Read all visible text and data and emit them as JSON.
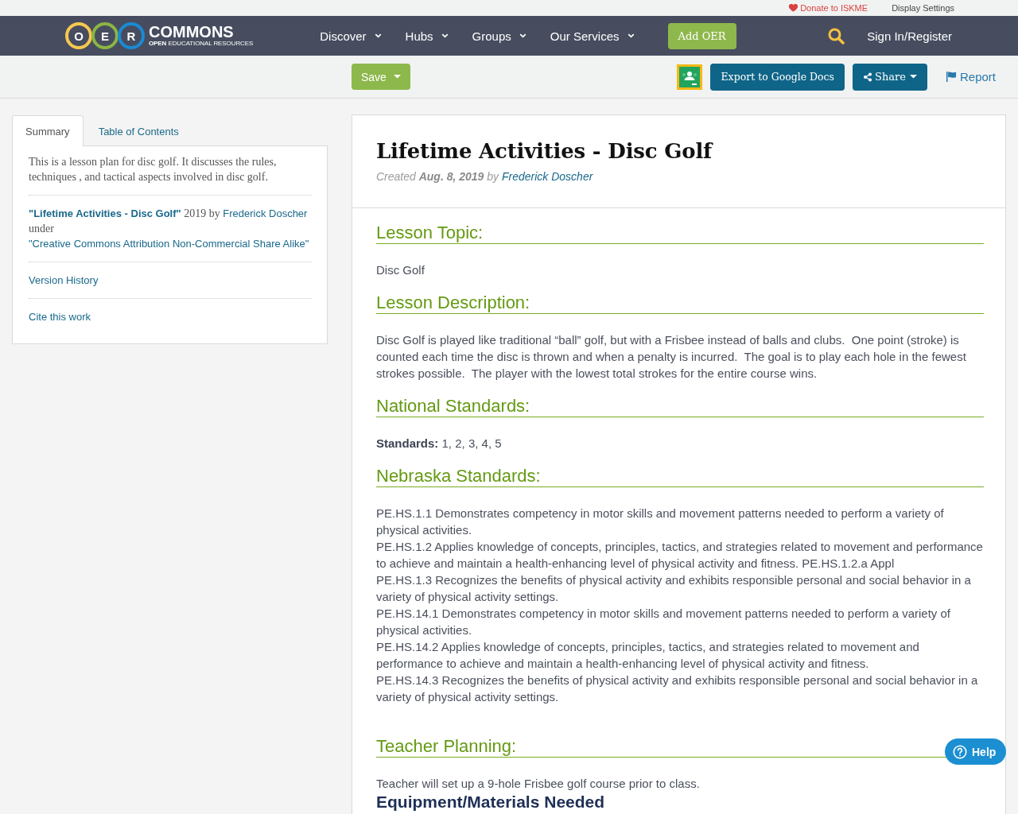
{
  "utility_bar": {
    "donate": "Donate to ISKME",
    "display_settings": "Display Settings"
  },
  "nav": {
    "logo": {
      "letters": [
        {
          "letter": "O",
          "color": "#f6c84f"
        },
        {
          "letter": "E",
          "color": "#8bb545"
        },
        {
          "letter": "R",
          "color": "#1b8ad3"
        }
      ],
      "wordmark": "COMMONS",
      "tagline": "**OPEN** EDUCATIONAL RESOURCES"
    },
    "items": [
      "Discover",
      "Hubs",
      "Groups",
      "Our Services"
    ],
    "add_button": "Add OER",
    "sign_in": "Sign In/Register"
  },
  "toolbar": {
    "save": "Save",
    "export": "Export to Google Docs",
    "share": "Share",
    "report": "Report"
  },
  "sidebar": {
    "tabs": [
      {
        "label": "Summary",
        "selected": true
      },
      {
        "label": "Table of Contents",
        "selected": false
      }
    ],
    "summary": "This is a lesson plan for disc golf. It discusses the rules, techniques , and tactical aspects involved in disc golf.",
    "attribution": {
      "title": "\"Lifetime Activities - Disc Golf\"",
      "year_by": " 2019 by ",
      "author": "Frederick Doscher",
      "under": "under ",
      "license": "\"Creative Commons Attribution Non-Commercial Share Alike\""
    },
    "links": [
      "Version History",
      "Cite this work"
    ]
  },
  "article": {
    "title": "Lifetime Activities - Disc Golf",
    "created": "Created **Aug. 8, 2019** by",
    "author": "Frederick Doscher",
    "sections": [
      {
        "heading": "Lesson Topic:",
        "kind": "text",
        "body": "Disc Golf"
      },
      {
        "heading": "Lesson Description:",
        "kind": "text",
        "body": "Disc Golf is played like traditional “ball” golf, but with a Frisbee instead of balls and clubs.  One point (stroke) is counted each time the disc is thrown and when a penalty is incurred.  The goal is to play each hole in the fewest strokes possible.  The player with the lowest total strokes for the entire course wins."
      },
      {
        "heading": "National Standards:",
        "kind": "text",
        "body": "**Standards:** 1, 2, 3, 4, 5"
      },
      {
        "heading": "Nebraska Standards:",
        "kind": "list",
        "items": [
          "PE.HS.1.1 Demonstrates competency in motor skills and movement patterns needed to perform a variety of physical activities.",
          "PE.HS.1.2 Applies knowledge of concepts, principles, tactics, and strategies related to movement and performance to achieve and maintain a health-enhancing level of physical activity and fitness. PE.HS.1.2.a Appl",
          "PE.HS.1.3 Recognizes the benefits of physical activity and exhibits responsible personal and social behavior in a variety of physical activity settings.",
          "PE.HS.14.1 Demonstrates competency in motor skills and movement patterns needed to perform a variety of physical activities.",
          "PE.HS.14.2 Applies knowledge of concepts, principles, tactics, and strategies related to movement and performance to achieve and maintain a health-enhancing level of physical activity and fitness.",
          "PE.HS.14.3 Recognizes the benefits of physical activity and exhibits responsible personal and social behavior in a variety of physical activity settings."
        ]
      },
      {
        "heading": "Teacher Planning:",
        "kind": "text",
        "body": "Teacher will set up a 9-hole Frisbee golf course prior to class."
      }
    ],
    "next_heading": "Equipment/Materials Needed"
  },
  "help_button": "Help"
}
